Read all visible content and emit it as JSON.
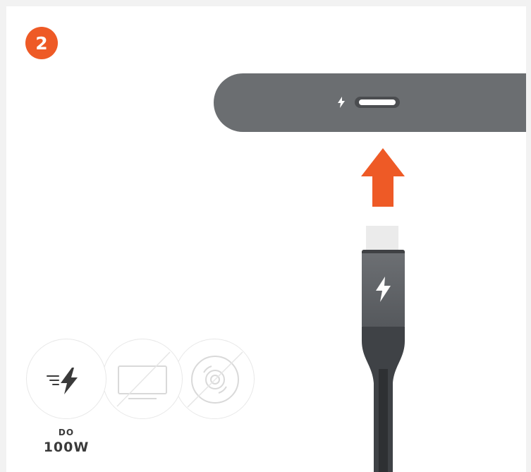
{
  "step": {
    "number": "2"
  },
  "colors": {
    "accent": "#ee5a26",
    "device": "#6b6e71",
    "cable": "#3f4246",
    "muted_icon": "#d9d9d9"
  },
  "features": [
    {
      "icon": "fast-charge-icon",
      "enabled": true
    },
    {
      "icon": "monitor-disabled-icon",
      "enabled": false
    },
    {
      "icon": "disc-disabled-icon",
      "enabled": false
    }
  ],
  "power_caption": {
    "top": "DO",
    "bottom": "100W"
  }
}
